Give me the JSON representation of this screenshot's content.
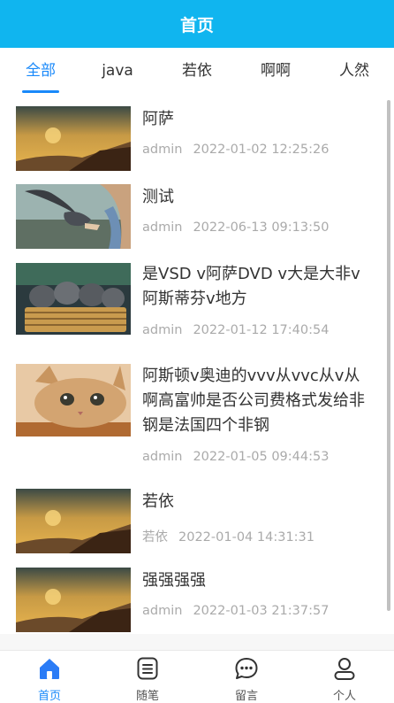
{
  "header": {
    "title": "首页"
  },
  "tabs": [
    {
      "label": "全部",
      "active": true
    },
    {
      "label": "java"
    },
    {
      "label": "若依"
    },
    {
      "label": "啊啊"
    },
    {
      "label": "人然"
    }
  ],
  "articles": [
    {
      "title": "阿萨",
      "author": "admin",
      "date": "2022-01-02 12:25:26",
      "image": "sunset-landscape"
    },
    {
      "title": "测试",
      "author": "admin",
      "date": "2022-06-13 09:13:50",
      "image": "bird-on-hand"
    },
    {
      "title": "是VSD v阿萨DVD v大是大非v阿斯蒂芬v地方",
      "author": "admin",
      "date": "2022-01-12 17:40:54",
      "image": "kittens-in-basket"
    },
    {
      "title": "阿斯顿v奥迪的vvv从vvc从v从啊高富帅是否公司费格式发给非钢是法国四个非钢",
      "author": "admin",
      "date": "2022-01-05 09:44:53",
      "image": "cat-face"
    },
    {
      "title": "若依",
      "author": "若依",
      "date": "2022-01-04 14:31:31",
      "image": "sunset-landscape"
    },
    {
      "title": "强强强强",
      "author": "admin",
      "date": "2022-01-03 21:37:57",
      "image": "sunset-landscape"
    }
  ],
  "tabbar": [
    {
      "label": "首页",
      "icon": "home-icon",
      "active": true
    },
    {
      "label": "随笔",
      "icon": "note-icon"
    },
    {
      "label": "留言",
      "icon": "message-icon"
    },
    {
      "label": "个人",
      "icon": "user-icon"
    }
  ],
  "colors": {
    "header": "#10b5ef",
    "accent": "#1989fa",
    "meta": "#aaaaaa"
  }
}
